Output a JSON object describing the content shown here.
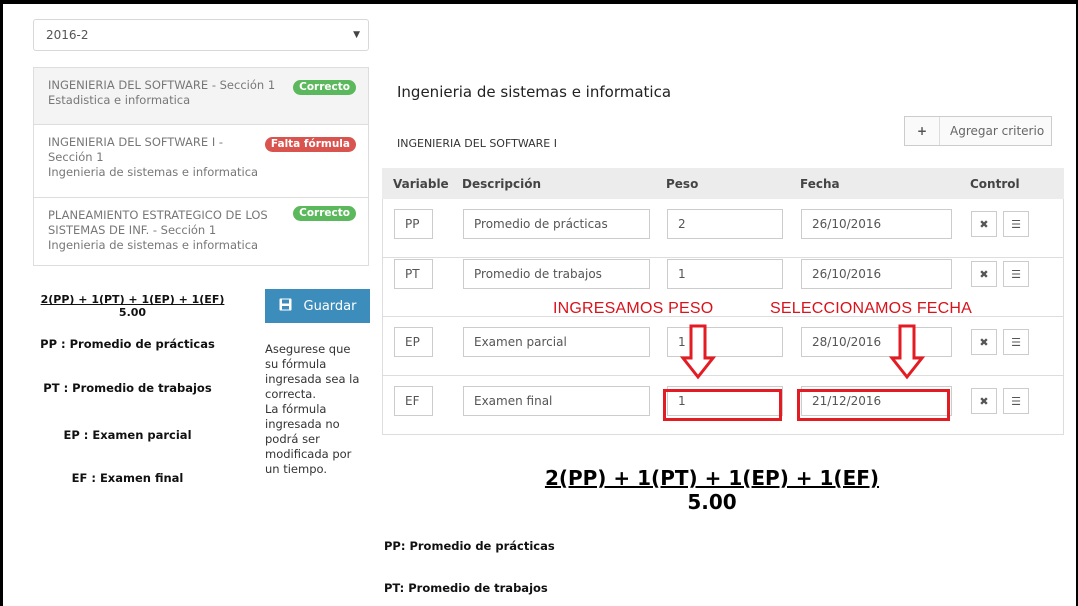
{
  "period_select": {
    "value": "2016-2"
  },
  "courses": [
    {
      "name": "INGENIERIA DEL SOFTWARE - Sección 1",
      "school": "Estadistica e informatica",
      "status": "Correcto"
    },
    {
      "name": "INGENIERIA DEL SOFTWARE I -",
      "name2": "Sección 1",
      "school": "Ingenieria de sistemas e informatica",
      "status": "Falta fórmula"
    },
    {
      "name": "PLANEAMIENTO ESTRATEGICO DE LOS",
      "name2": "SISTEMAS DE INF. - Sección 1",
      "school": "Ingenieria de sistemas e informatica",
      "status": "Correcto"
    }
  ],
  "left_panel": {
    "formula": "2(PP) + 1(PT) + 1(EP) + 1(EF)",
    "result": "5.00",
    "legend": [
      "PP : Promedio de prácticas",
      "PT : Promedio de trabajos",
      "EP : Examen parcial",
      "EF : Examen final"
    ],
    "save_label": "Guardar",
    "warning": [
      "Asegurese que",
      "su fórmula",
      "ingresada sea la",
      "correcta.",
      "La fórmula",
      "ingresada no",
      "podrá ser",
      "modificada por",
      "un tiempo."
    ]
  },
  "main": {
    "title": "Ingenieria de sistemas e informatica",
    "course": "INGENIERIA DEL SOFTWARE I",
    "add_label": "Agregar criterio",
    "columns": [
      "Variable",
      "Descripción",
      "Peso",
      "Fecha",
      "Control"
    ],
    "rows": [
      {
        "variable": "PP",
        "descripcion": "Promedio de prácticas",
        "peso": "2",
        "fecha": "26/10/2016"
      },
      {
        "variable": "PT",
        "descripcion": "Promedio de trabajos",
        "peso": "1",
        "fecha": "26/10/2016"
      },
      {
        "variable": "EP",
        "descripcion": "Examen parcial",
        "peso": "1",
        "fecha": "28/10/2016"
      },
      {
        "variable": "EF",
        "descripcion": "Examen final",
        "peso": "1",
        "fecha": "21/12/2016"
      }
    ],
    "formula": "2(PP) + 1(PT) + 1(EP) + 1(EF)",
    "result": "5.00",
    "definitions": [
      "PP: Promedio de prácticas",
      "PT: Promedio de trabajos"
    ]
  },
  "annotations": {
    "peso": "INGRESAMOS PESO",
    "fecha": "SELECCIONAMOS FECHA",
    "color": "#e31b23"
  },
  "icons": {
    "remove": "close-icon",
    "detail": "list-icon",
    "save": "floppy-disk-icon",
    "add": "plus-icon",
    "caret": "caret-down-icon"
  }
}
